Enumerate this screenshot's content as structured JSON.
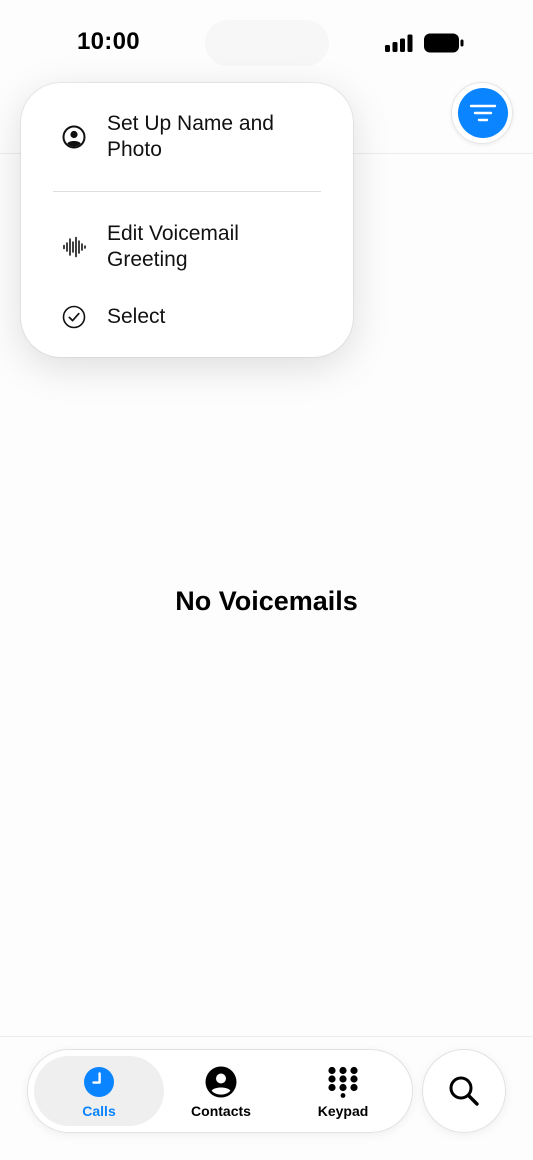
{
  "status_bar": {
    "time": "10:00",
    "icons": [
      "cellular-signal-icon",
      "battery-icon"
    ]
  },
  "header": {
    "filter_icon": "filter-lines-icon",
    "accent_color": "#0a84ff"
  },
  "menu": {
    "items": [
      {
        "label": "Set Up Name and Photo",
        "icon": "person-circle-icon"
      },
      {
        "label": "Edit Voicemail Greeting",
        "icon": "waveform-icon"
      },
      {
        "label": "Select",
        "icon": "checkmark-circle-icon"
      }
    ]
  },
  "main": {
    "empty_title": "No Voicemails"
  },
  "tab_bar": {
    "tabs": [
      {
        "label": "Calls",
        "icon": "clock-icon",
        "selected": true
      },
      {
        "label": "Contacts",
        "icon": "person-circle-icon",
        "selected": false
      },
      {
        "label": "Keypad",
        "icon": "keypad-icon",
        "selected": false
      }
    ],
    "search_icon": "magnifying-glass-icon"
  }
}
